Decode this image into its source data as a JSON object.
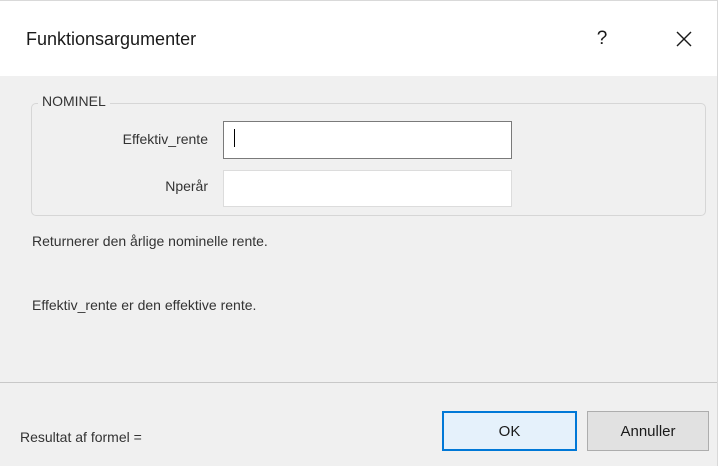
{
  "window": {
    "title": "Funktionsargumenter",
    "help_label": "?",
    "close_label": "Close"
  },
  "function": {
    "name": "NOMINEL",
    "arguments": [
      {
        "label": "Effektiv_rente",
        "value": ""
      },
      {
        "label": "Nperår",
        "value": ""
      }
    ],
    "description": "Returnerer den årlige nominelle rente.",
    "argument_help": "Effektiv_rente er den effektive rente."
  },
  "result": {
    "label": "Resultat af formel ="
  },
  "buttons": {
    "ok": "OK",
    "cancel": "Annuller"
  },
  "colors": {
    "accent": "#0078d7",
    "dialog_bg": "#f0f0f0"
  }
}
